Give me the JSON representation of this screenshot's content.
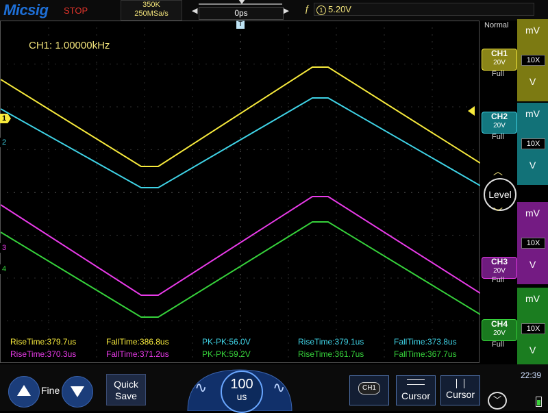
{
  "header": {
    "logo": "Micsig",
    "run_state": "STOP",
    "memory_depth": "350K",
    "sample_rate": "250MSa/s",
    "time_offset": "0ps",
    "trigger_source": "1",
    "trigger_level": "5.20V"
  },
  "screen": {
    "frequency_readout": "CH1: 1.00000kHz",
    "acquisition_mode": "Normal",
    "trigger_position_marker": "T"
  },
  "channels": [
    {
      "id": "CH1",
      "marker": "1",
      "scale": "20V",
      "bw": "Full",
      "unit_top": "mV",
      "probe": "10X",
      "unit_bottom": "V",
      "color": "#f7ea3c",
      "btn_color": "#8a8518",
      "panel_color": "#7c7a12"
    },
    {
      "id": "CH2",
      "marker": "2",
      "scale": "20V",
      "bw": "Full",
      "unit_top": "mV",
      "probe": "10X",
      "unit_bottom": "V",
      "color": "#3fd3e6",
      "btn_color": "#137880",
      "panel_color": "#127278"
    },
    {
      "id": "CH3",
      "marker": "3",
      "scale": "20V",
      "bw": "Full",
      "unit_top": "mV",
      "probe": "10X",
      "unit_bottom": "V",
      "color": "#e93be9",
      "btn_color": "#6e1b7e",
      "panel_color": "#741b83"
    },
    {
      "id": "CH4",
      "marker": "4",
      "scale": "20V",
      "bw": "Full",
      "unit_top": "mV",
      "probe": "10X",
      "unit_bottom": "V",
      "color": "#36d23b",
      "btn_color": "#1a7a1f",
      "panel_color": "#1b7d20"
    }
  ],
  "measurements": {
    "row1": [
      {
        "label": "RiseTime:379.7us",
        "color": "#f7ea3c"
      },
      {
        "label": "FallTime:386.8us",
        "color": "#f7ea3c"
      },
      {
        "label": "PK-PK:56.0V",
        "color": "#3fd3e6"
      },
      {
        "label": "RiseTime:379.1us",
        "color": "#3fd3e6"
      },
      {
        "label": "FallTime:373.8us",
        "color": "#3fd3e6"
      }
    ],
    "row2": [
      {
        "label": "RiseTime:370.3us",
        "color": "#e93be9"
      },
      {
        "label": "FallTime:371.2us",
        "color": "#e93be9"
      },
      {
        "label": "PK-PK:59.2V",
        "color": "#36d23b"
      },
      {
        "label": "RiseTime:361.7us",
        "color": "#36d23b"
      },
      {
        "label": "FallTime:367.7us",
        "color": "#36d23b"
      }
    ]
  },
  "controls": {
    "level_knob": "Level",
    "fine_label": "Fine",
    "quick_save_line1": "Quick",
    "quick_save_line2": "Save",
    "timebase_value": "100",
    "timebase_unit": "us",
    "channel_stack_label": "CH1",
    "cursor_h_label": "Cursor",
    "cursor_v_label": "Cursor",
    "clock": "22:39"
  }
}
